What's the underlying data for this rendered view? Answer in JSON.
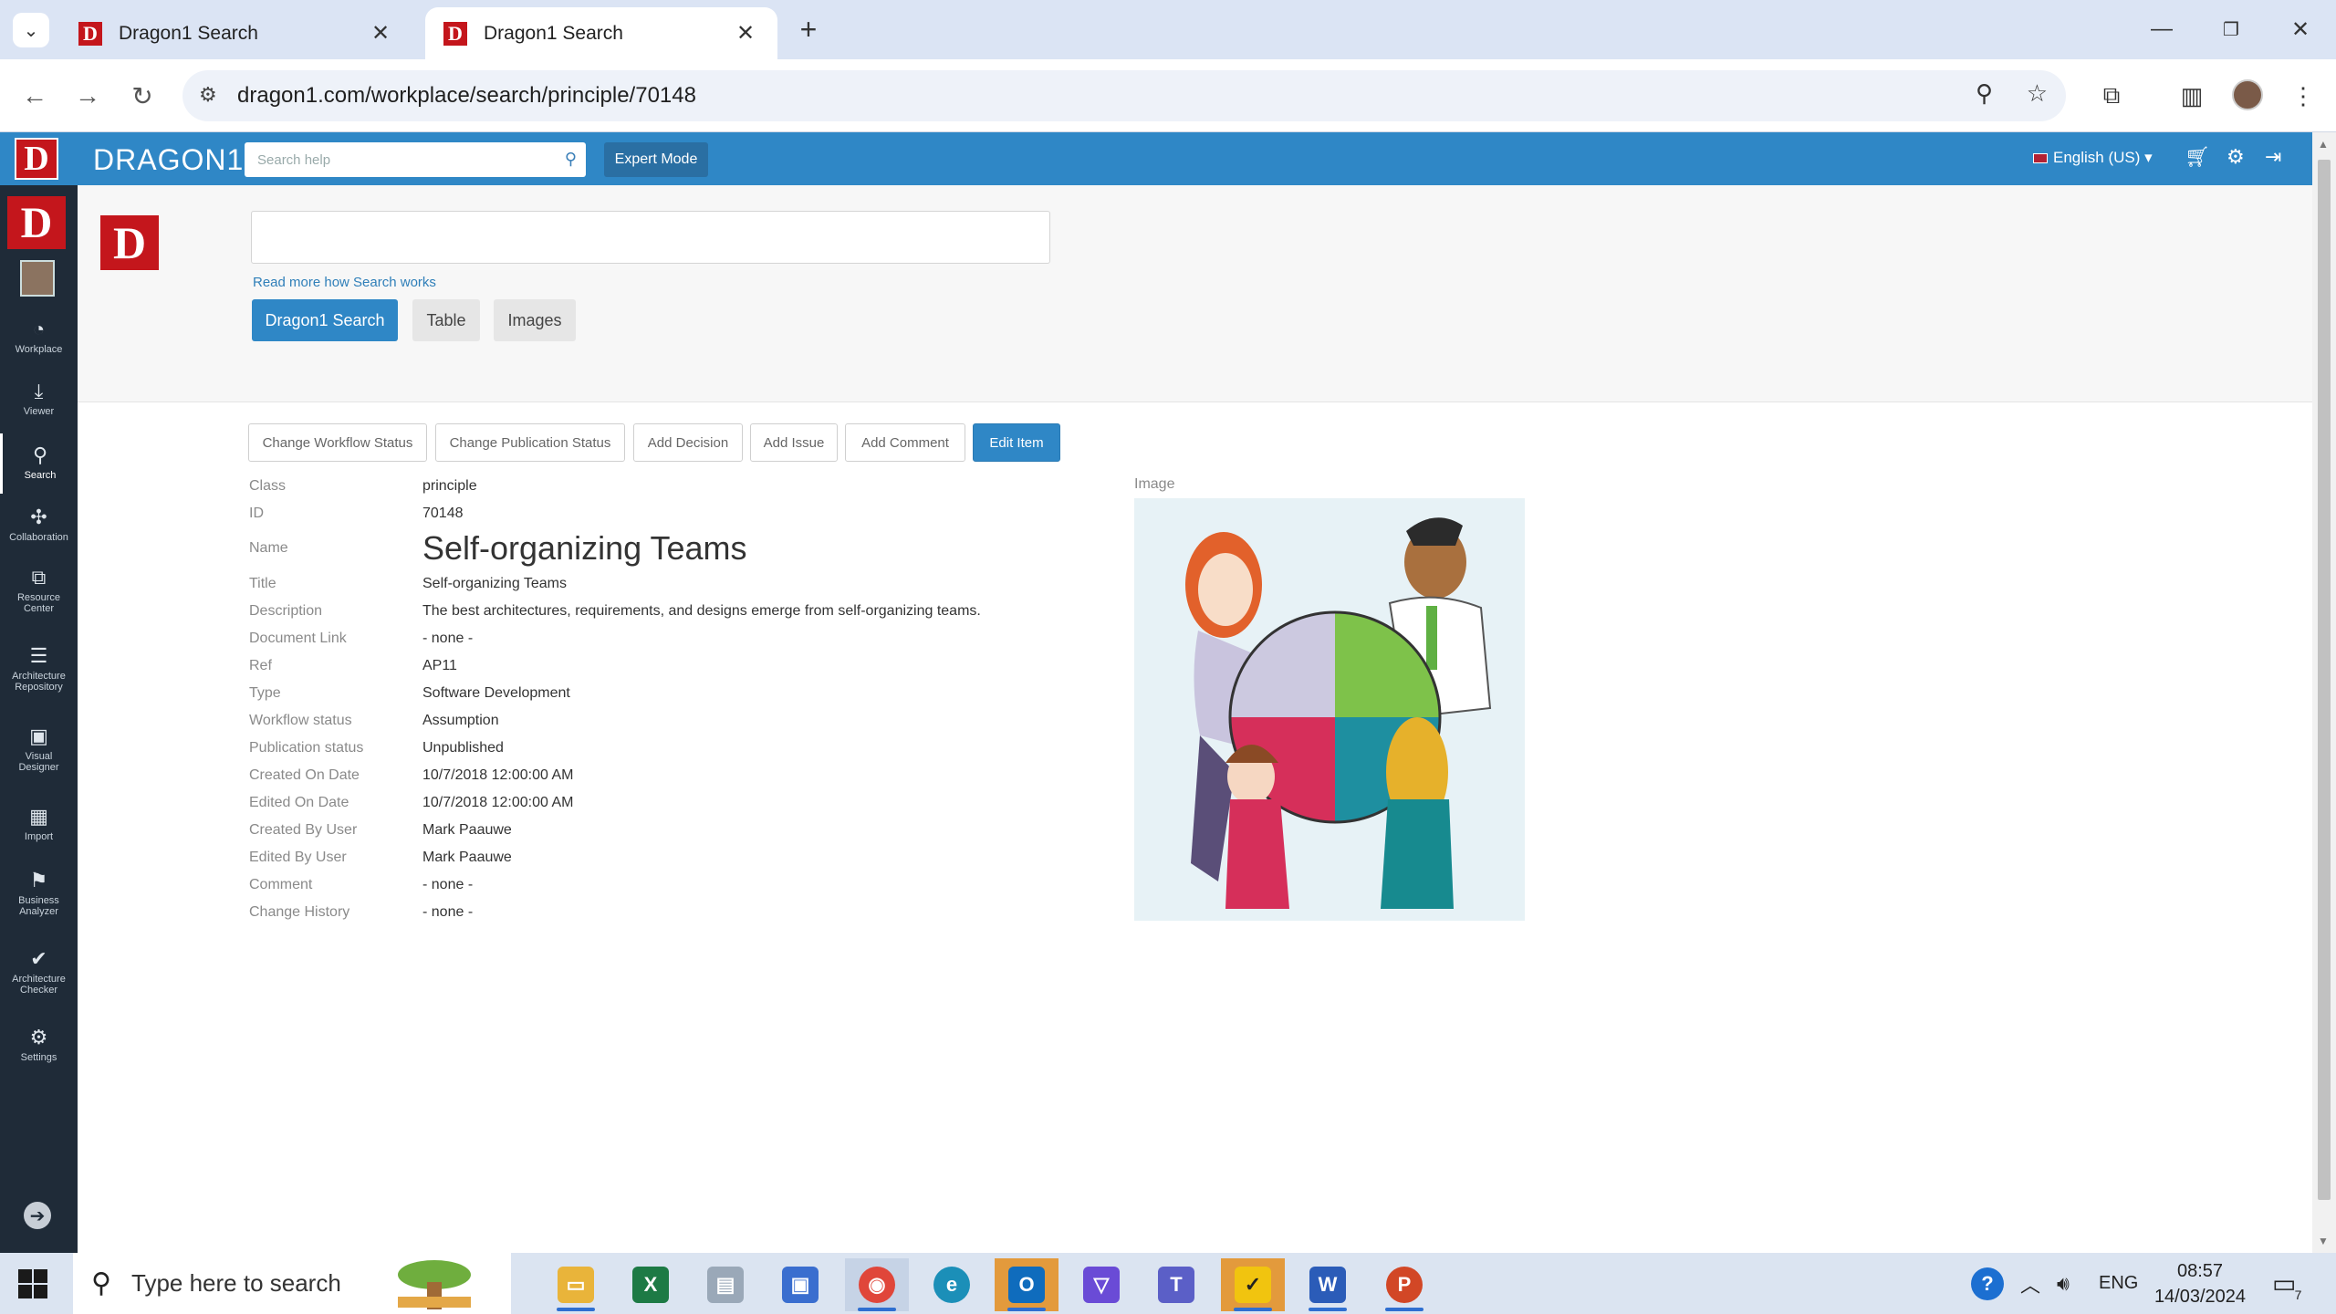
{
  "browser": {
    "tabs": [
      {
        "title": "Dragon1 Search",
        "active": false
      },
      {
        "title": "Dragon1 Search",
        "active": true
      }
    ],
    "url": "dragon1.com/workplace/search/principle/70148"
  },
  "app": {
    "brand": "DRAGON1",
    "logo_letter": "D",
    "help_search_placeholder": "Search help",
    "expert_mode_label": "Expert Mode",
    "language": "English (US)"
  },
  "sidebar": {
    "items": [
      {
        "label": "Workplace",
        "icon": "dashboard-icon"
      },
      {
        "label": "Viewer",
        "icon": "download-icon"
      },
      {
        "label": "Search",
        "icon": "search-icon"
      },
      {
        "label": "Collaboration",
        "icon": "puzzle-icon"
      },
      {
        "label": "Resource Center",
        "icon": "copy-icon"
      },
      {
        "label": "Architecture Repository",
        "icon": "database-icon"
      },
      {
        "label": "Visual Designer",
        "icon": "image-icon"
      },
      {
        "label": "Import",
        "icon": "table-icon"
      },
      {
        "label": "Business Analyzer",
        "icon": "flag-icon"
      },
      {
        "label": "Architecture Checker",
        "icon": "check-icon"
      },
      {
        "label": "Settings",
        "icon": "gear-icon"
      }
    ]
  },
  "search": {
    "query": "",
    "read_more": "Read more how Search works",
    "modes": [
      "Dragon1 Search",
      "Table",
      "Images"
    ]
  },
  "actions": [
    "Change Workflow Status",
    "Change Publication Status",
    "Add Decision",
    "Add Issue",
    "Add Comment",
    "Edit Item"
  ],
  "details": [
    {
      "label": "Class",
      "value": "principle"
    },
    {
      "label": "ID",
      "value": "70148"
    },
    {
      "label": "Name",
      "value": "Self-organizing Teams"
    },
    {
      "label": "Title",
      "value": "Self-organizing Teams"
    },
    {
      "label": "Description",
      "value": "The best architectures, requirements, and designs emerge from self-organizing teams."
    },
    {
      "label": "Document Link",
      "value": "- none -"
    },
    {
      "label": "Ref",
      "value": "AP11"
    },
    {
      "label": "Type",
      "value": "Software Development"
    },
    {
      "label": "Workflow status",
      "value": "Assumption"
    },
    {
      "label": "Publication status",
      "value": "Unpublished"
    },
    {
      "label": "Created On Date",
      "value": "10/7/2018 12:00:00 AM"
    },
    {
      "label": "Edited On Date",
      "value": "10/7/2018 12:00:00 AM"
    },
    {
      "label": "Created By User",
      "value": "Mark Paauwe"
    },
    {
      "label": "Edited By User",
      "value": "Mark Paauwe"
    },
    {
      "label": "Comment",
      "value": "- none -"
    },
    {
      "label": "Change History",
      "value": "- none -"
    }
  ],
  "image_label": "Image",
  "taskbar": {
    "search_placeholder": "Type here to search",
    "language": "ENG",
    "time": "08:57",
    "date": "14/03/2024",
    "notification_count": "7"
  },
  "colors": {
    "accent": "#2f87c6",
    "brand_red": "#c4161c",
    "sidebar": "#1f2b38"
  }
}
